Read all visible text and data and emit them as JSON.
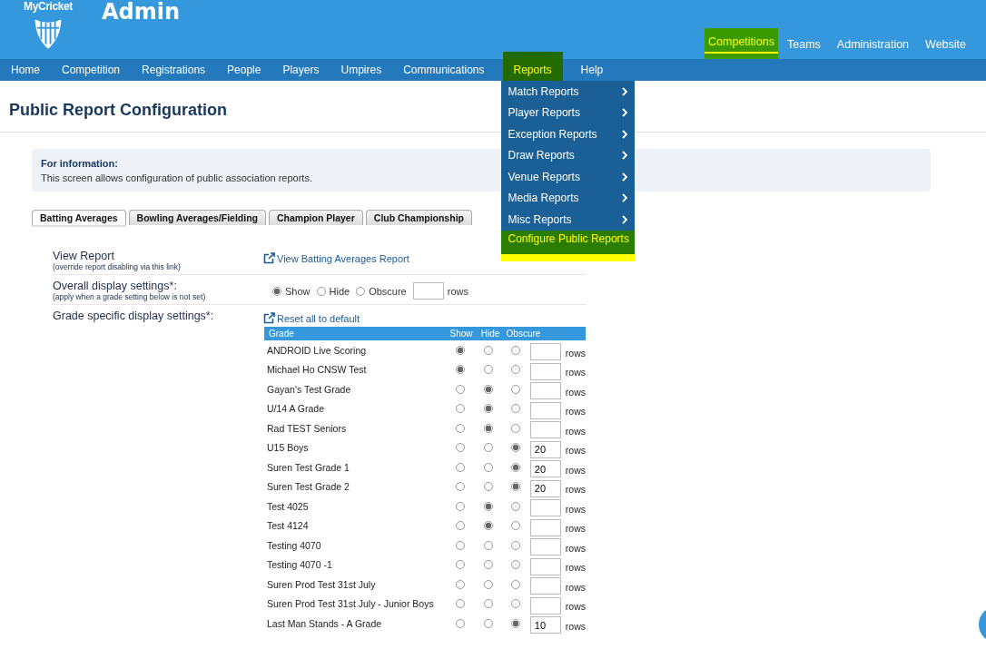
{
  "header": {
    "logo_text": "MyCricket",
    "title": "Admin",
    "top_nav": [
      {
        "label": "Competitions",
        "selected": true
      },
      {
        "label": "Teams",
        "selected": false
      },
      {
        "label": "Administration",
        "selected": false
      },
      {
        "label": "Website",
        "selected": false
      }
    ]
  },
  "main_nav": [
    {
      "label": "Home",
      "selected": false
    },
    {
      "label": "Competition",
      "selected": false
    },
    {
      "label": "Registrations",
      "selected": false
    },
    {
      "label": "People",
      "selected": false
    },
    {
      "label": "Players",
      "selected": false
    },
    {
      "label": "Umpires",
      "selected": false
    },
    {
      "label": "Communications",
      "selected": false
    },
    {
      "label": "Reports",
      "selected": true
    },
    {
      "label": "Help",
      "selected": false
    }
  ],
  "reports_menu": [
    {
      "label": "Match Reports",
      "kind": "submenu",
      "selected": false
    },
    {
      "label": "Player Reports",
      "kind": "submenu",
      "selected": false
    },
    {
      "label": "Exception Reports",
      "kind": "submenu",
      "selected": false
    },
    {
      "label": "Draw Reports",
      "kind": "submenu",
      "selected": false
    },
    {
      "label": "Venue Reports",
      "kind": "submenu",
      "selected": false
    },
    {
      "label": "Media Reports",
      "kind": "submenu",
      "selected": false
    },
    {
      "label": "Misc Reports",
      "kind": "submenu",
      "selected": false
    },
    {
      "label": "Configure Public Reports",
      "kind": "link",
      "selected": true
    }
  ],
  "page_title": "Public Report Configuration",
  "info": {
    "heading": "For information:",
    "text": "This screen allows configuration of public association reports."
  },
  "tabs": [
    {
      "label": "Batting Averages",
      "selected": true
    },
    {
      "label": "Bowling Averages/Fielding",
      "selected": false
    },
    {
      "label": "Champion Player",
      "selected": false
    },
    {
      "label": "Club Championship",
      "selected": false
    }
  ],
  "view_report": {
    "label": "View Report",
    "note": "(override report disabling via this link)",
    "link": "View Batting Averages Report"
  },
  "overall": {
    "label": "Overall display settings*:",
    "note": "(apply when a grade setting below is not set)",
    "options": [
      {
        "label": "Show",
        "selected": true
      },
      {
        "label": "Hide",
        "selected": false
      },
      {
        "label": "Obscure",
        "selected": false
      }
    ],
    "rows_unit": "rows"
  },
  "grade_settings": {
    "label": "Grade specific display settings*:",
    "reset_link": "Reset all to default"
  },
  "grades_table": {
    "columns": [
      "Grade",
      "Show",
      "Hide",
      "Obscure"
    ],
    "rows": [
      {
        "grade": "ANDROID Live Scoring",
        "choices": [
          {
            "selected": true
          },
          {
            "selected": false
          },
          {
            "selected": false
          }
        ],
        "unit": "rows"
      },
      {
        "grade": "Michael Ho CNSW Test",
        "choices": [
          {
            "selected": true
          },
          {
            "selected": false
          },
          {
            "selected": false
          }
        ],
        "unit": "rows"
      },
      {
        "grade": "Gayan's Test Grade",
        "choices": [
          {
            "selected": false
          },
          {
            "selected": true
          },
          {
            "selected": false
          }
        ],
        "unit": "rows"
      },
      {
        "grade": "U/14 A Grade",
        "choices": [
          {
            "selected": false
          },
          {
            "selected": true
          },
          {
            "selected": false
          }
        ],
        "unit": "rows"
      },
      {
        "grade": "Rad TEST Seniors",
        "choices": [
          {
            "selected": false
          },
          {
            "selected": true
          },
          {
            "selected": false
          }
        ],
        "unit": "rows"
      },
      {
        "grade": "U15 Boys",
        "choices": [
          {
            "selected": false
          },
          {
            "selected": false
          },
          {
            "selected": true
          }
        ],
        "rows": "20",
        "unit": "rows"
      },
      {
        "grade": "Suren Test Grade 1",
        "choices": [
          {
            "selected": false
          },
          {
            "selected": false
          },
          {
            "selected": true
          }
        ],
        "rows": "20",
        "unit": "rows"
      },
      {
        "grade": "Suren Test Grade 2",
        "choices": [
          {
            "selected": false
          },
          {
            "selected": false
          },
          {
            "selected": true
          }
        ],
        "rows": "20",
        "unit": "rows"
      },
      {
        "grade": "Test 4025",
        "choices": [
          {
            "selected": false
          },
          {
            "selected": true
          },
          {
            "selected": false
          }
        ],
        "unit": "rows"
      },
      {
        "grade": "Test 4124",
        "choices": [
          {
            "selected": false
          },
          {
            "selected": true
          },
          {
            "selected": false
          }
        ],
        "unit": "rows"
      },
      {
        "grade": "Testing 4070",
        "choices": [
          {
            "selected": false
          },
          {
            "selected": false
          },
          {
            "selected": false
          }
        ],
        "unit": "rows"
      },
      {
        "grade": "Testing 4070 -1",
        "choices": [
          {
            "selected": false
          },
          {
            "selected": false
          },
          {
            "selected": false
          }
        ],
        "unit": "rows"
      },
      {
        "grade": "Suren Prod Test 31st July",
        "choices": [
          {
            "selected": false
          },
          {
            "selected": false
          },
          {
            "selected": false
          }
        ],
        "unit": "rows"
      },
      {
        "grade": "Suren Prod Test 31st July - Junior Boys",
        "choices": [
          {
            "selected": false
          },
          {
            "selected": false
          },
          {
            "selected": false
          }
        ],
        "unit": "rows"
      },
      {
        "grade": "Last Man Stands - A Grade",
        "choices": [
          {
            "selected": false
          },
          {
            "selected": false
          },
          {
            "selected": true
          }
        ],
        "rows": "10",
        "unit": "rows"
      }
    ]
  }
}
